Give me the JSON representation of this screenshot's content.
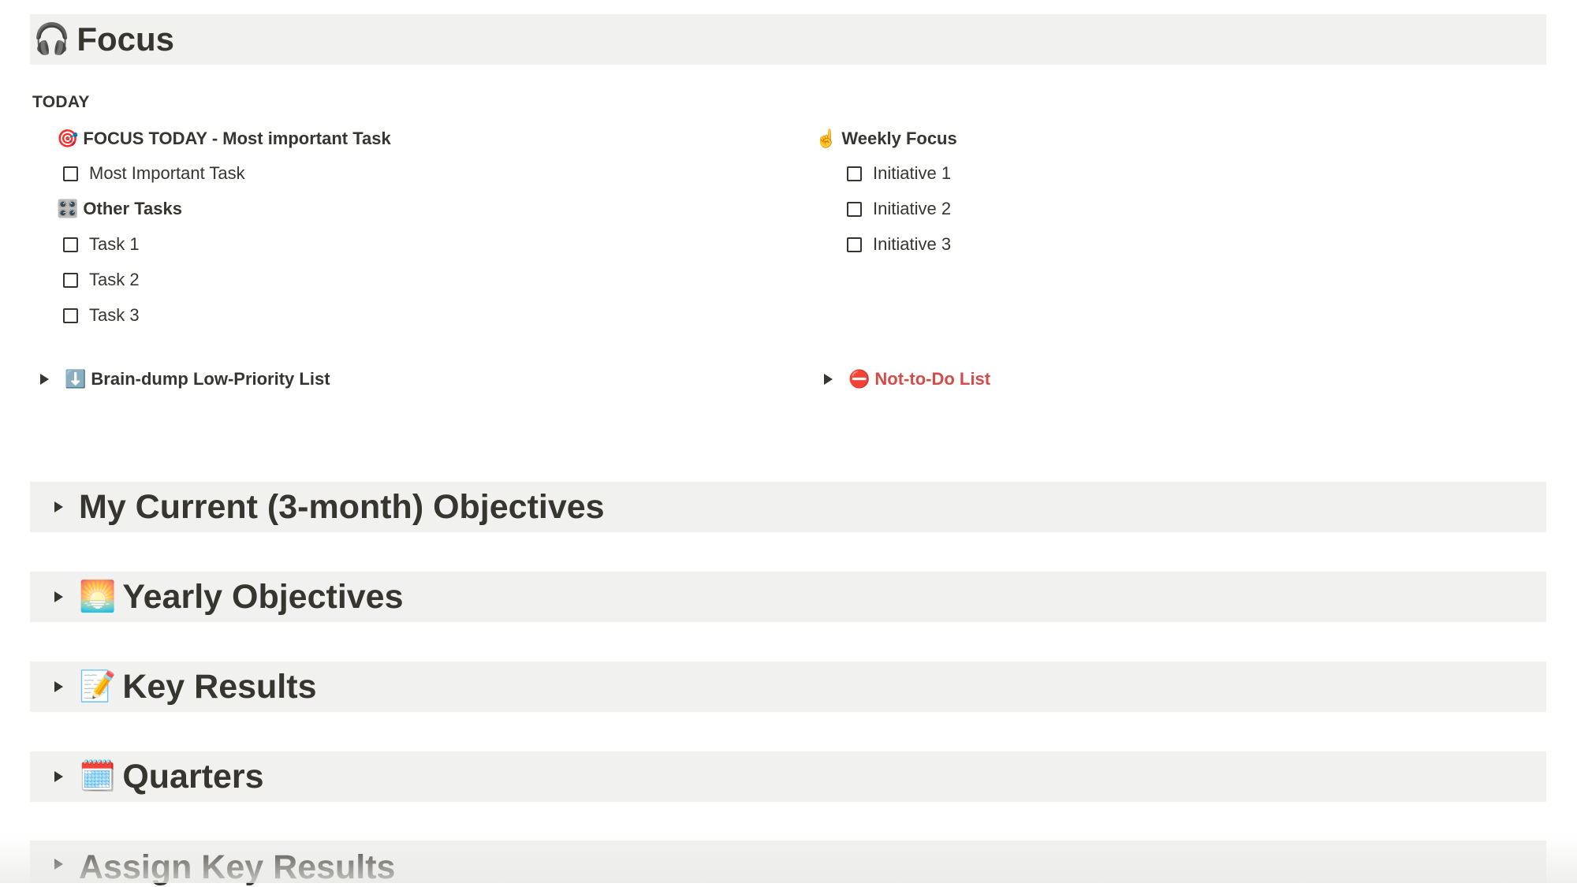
{
  "focus": {
    "icon": "🎧",
    "title": "Focus"
  },
  "today": {
    "label": "TODAY",
    "left": {
      "mit_heading_icon": "🎯",
      "mit_heading": "FOCUS TODAY - Most important Task",
      "mit_task": "Most Important Task",
      "other_heading_icon": "🎛️",
      "other_heading": "Other Tasks",
      "tasks": [
        "Task 1",
        "Task 2",
        "Task 3"
      ]
    },
    "right": {
      "weekly_heading_icon": "☝️",
      "weekly_heading": "Weekly Focus",
      "initiatives": [
        "Initiative 1",
        "Initiative 2",
        "Initiative 3"
      ]
    }
  },
  "toggles": {
    "brain_dump_icon": "⬇️",
    "brain_dump": "Brain-dump Low-Priority List",
    "not_to_do_icon": "⛔",
    "not_to_do": "Not-to-Do List",
    "not_to_do_color": "#d44c47"
  },
  "sections": {
    "current_objectives": {
      "icon": "",
      "title": "My Current (3-month) Objectives"
    },
    "yearly_objectives": {
      "icon": "🌅",
      "title": "Yearly Objectives"
    },
    "key_results": {
      "icon": "📝",
      "title": "Key Results"
    },
    "quarters": {
      "icon": "🗓️",
      "title": "Quarters"
    },
    "assign_key_results": {
      "icon": "",
      "title": "Assign Key Results"
    }
  },
  "colors": {
    "text": "#37352f",
    "header_bg": "#f1f1ef",
    "accent_red": "#d44c47"
  }
}
